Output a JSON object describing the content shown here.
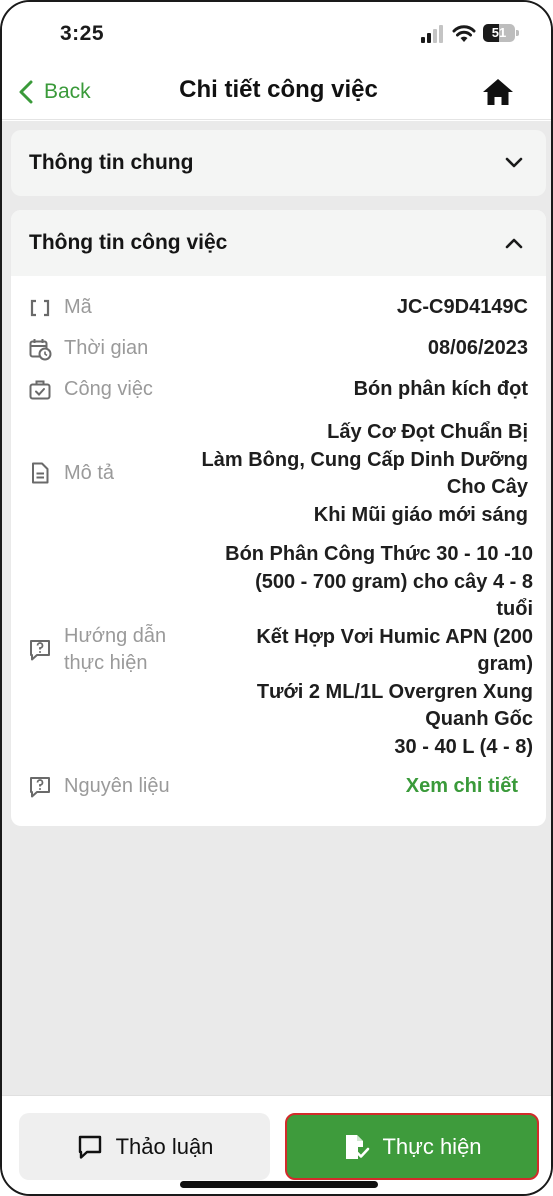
{
  "status_bar": {
    "time": "3:25",
    "battery": "51",
    "battery_level": 0.51
  },
  "header": {
    "back_label": "Back",
    "title": "Chi tiết công việc"
  },
  "general_section": {
    "title": "Thông tin chung",
    "expanded": false
  },
  "job_section": {
    "title": "Thông tin công việc",
    "expanded": true,
    "rows": [
      {
        "icon": "brackets-icon",
        "label": "Mã",
        "value": [
          "JC-C9D4149C"
        ]
      },
      {
        "icon": "calendar-clock-icon",
        "label": "Thời gian",
        "value": [
          "08/06/2023"
        ]
      },
      {
        "icon": "briefcase-check-icon",
        "label": "Công việc",
        "value": [
          "Bón phân kích đọt"
        ]
      },
      {
        "icon": "document-icon",
        "label": "Mô tả",
        "value": [
          "Lấy Cơ Đọt Chuẩn Bị",
          "Làm Bông, Cung Cấp Dinh Dưỡng",
          "Cho Cây",
          "Khi Mũi giáo mới sáng"
        ]
      },
      {
        "icon": "help-chat-icon",
        "label_lines": [
          "Hướng dẫn",
          "thực hiện"
        ],
        "value": [
          "Bón Phân Công Thức 30 - 10 -10",
          "(500 - 700 gram) cho cây 4 - 8",
          "tuổi",
          "Kết Hợp Vơi Humic APN (200",
          "gram)",
          "Tưới 2 ML/1L Overgren Xung",
          "Quanh Gốc",
          "30 - 40 L (4 - 8)"
        ]
      },
      {
        "icon": "help-chat-icon",
        "label": "Nguyên liệu",
        "link": "Xem chi tiết"
      }
    ]
  },
  "actions": {
    "discuss_label": "Thảo luận",
    "execute_label": "Thực hiện"
  },
  "colors": {
    "accent": "#3e9b3c",
    "link": "#3a9a3a",
    "highlight_border": "#d22b2b",
    "background": "#eaeaea"
  }
}
